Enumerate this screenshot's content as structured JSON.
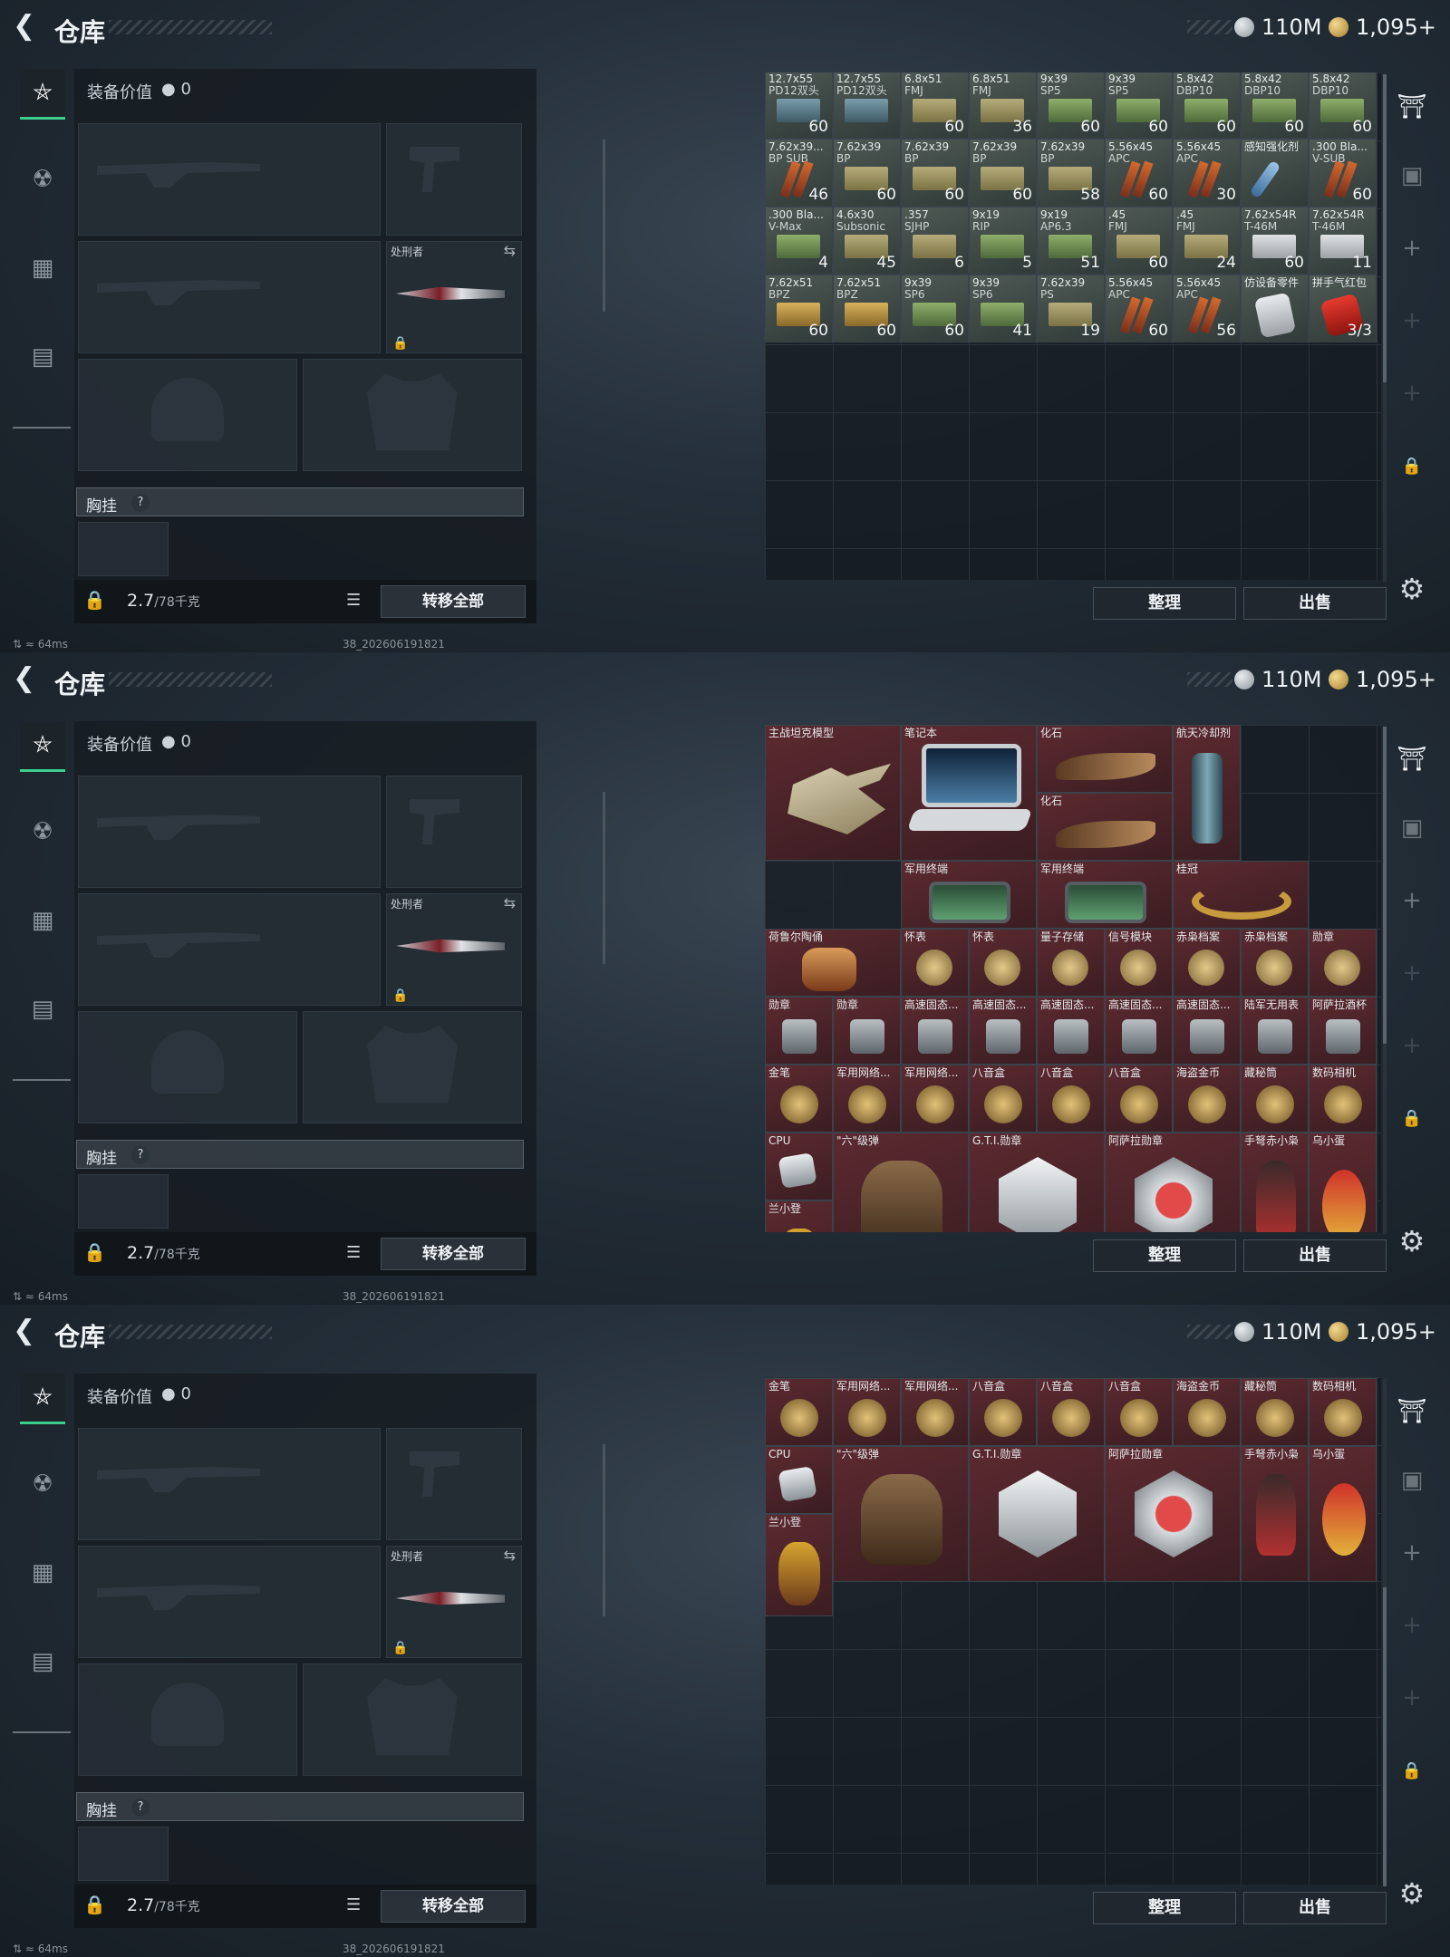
{
  "header": {
    "title": "仓库",
    "silver": "110M",
    "gold": "1,095+"
  },
  "equipment": {
    "value_label": "装备价值",
    "value": "0",
    "knife_label": "处刑者",
    "chest_label": "胸挂",
    "chest_help": "?",
    "weight": "2.7",
    "weight_max": "/78千克",
    "transfer_all": "转移全部"
  },
  "status": {
    "ping": "64ms",
    "build": "38_202606191821"
  },
  "actions": {
    "sort": "整理",
    "sell": "出售"
  },
  "panel1": {
    "rows": [
      [
        {
          "n": "12.7x55",
          "n2": "PD12双头",
          "c": "60",
          "k": "bl"
        },
        {
          "n": "12.7x55",
          "n2": "PD12双头",
          "c": "",
          "k": "bl"
        },
        {
          "n": "6.8x51",
          "n2": "FMJ",
          "c": "60",
          "k": ""
        },
        {
          "n": "6.8x51",
          "n2": "FMJ",
          "c": "36",
          "k": ""
        },
        {
          "n": "9x39",
          "n2": "SP5",
          "c": "60",
          "k": "gr"
        },
        {
          "n": "9x39",
          "n2": "SP5",
          "c": "60",
          "k": "gr"
        },
        {
          "n": "5.8x42",
          "n2": "DBP10",
          "c": "60",
          "k": "gr"
        },
        {
          "n": "5.8x42",
          "n2": "DBP10",
          "c": "60",
          "k": "gr"
        },
        {
          "n": "5.8x42",
          "n2": "DBP10",
          "c": "60",
          "k": "gr"
        }
      ],
      [
        {
          "n": "7.62x39...",
          "n2": "BP SUB",
          "c": "46",
          "k": "st"
        },
        {
          "n": "7.62x39",
          "n2": "BP",
          "c": "60",
          "k": ""
        },
        {
          "n": "7.62x39",
          "n2": "BP",
          "c": "60",
          "k": ""
        },
        {
          "n": "7.62x39",
          "n2": "BP",
          "c": "60",
          "k": ""
        },
        {
          "n": "7.62x39",
          "n2": "BP",
          "c": "58",
          "k": ""
        },
        {
          "n": "5.56x45",
          "n2": "APC",
          "c": "60",
          "k": "st"
        },
        {
          "n": "5.56x45",
          "n2": "APC",
          "c": "30",
          "k": "st"
        },
        {
          "n": "感知强化剂",
          "n2": "",
          "c": "",
          "k": "sy"
        },
        {
          "n": ".300 Bla...",
          "n2": "V-SUB",
          "c": "60",
          "k": "st"
        }
      ],
      [
        {
          "n": ".300 Bla...",
          "n2": "V-Max",
          "c": "4",
          "k": "gr"
        },
        {
          "n": "4.6x30",
          "n2": "Subsonic",
          "c": "45",
          "k": ""
        },
        {
          "n": ".357",
          "n2": "SJHP",
          "c": "6",
          "k": ""
        },
        {
          "n": "9x19",
          "n2": "RIP",
          "c": "5",
          "k": "gr"
        },
        {
          "n": "9x19",
          "n2": "AP6.3",
          "c": "51",
          "k": "gr"
        },
        {
          "n": ".45",
          "n2": "FMJ",
          "c": "60",
          "k": ""
        },
        {
          "n": ".45",
          "n2": "FMJ",
          "c": "24",
          "k": ""
        },
        {
          "n": "7.62x54R",
          "n2": "T-46M",
          "c": "60",
          "k": "wh"
        },
        {
          "n": "7.62x54R",
          "n2": "T-46M",
          "c": "11",
          "k": "wh"
        }
      ],
      [
        {
          "n": "7.62x51",
          "n2": "BPZ",
          "c": "60",
          "k": "gd"
        },
        {
          "n": "7.62x51",
          "n2": "BPZ",
          "c": "60",
          "k": "gd"
        },
        {
          "n": "9x39",
          "n2": "SP6",
          "c": "60",
          "k": "gr"
        },
        {
          "n": "9x39",
          "n2": "SP6",
          "c": "41",
          "k": "gr"
        },
        {
          "n": "7.62x39",
          "n2": "PS",
          "c": "19",
          "k": ""
        },
        {
          "n": "5.56x45",
          "n2": "APC",
          "c": "60",
          "k": "st"
        },
        {
          "n": "5.56x45",
          "n2": "APC",
          "c": "56",
          "k": "st"
        },
        {
          "n": "仿设备零件",
          "n2": "",
          "c": "",
          "k": "pk"
        },
        {
          "n": "拼手气红包",
          "n2": "",
          "c": "3/3",
          "k": "rd"
        }
      ]
    ]
  },
  "panel2": {
    "big": [
      {
        "label": "主战坦克模型",
        "art": "tank"
      },
      {
        "label": "笔记本",
        "art": "laptop"
      },
      {
        "label": "化石",
        "art": "fossil"
      },
      {
        "label": "化石",
        "art": "fossil"
      },
      {
        "label": "航天冷却剂",
        "art": "cool"
      },
      {
        "label": "军用终端",
        "art": "term"
      },
      {
        "label": "军用终端",
        "art": "term"
      },
      {
        "label": "桂冠",
        "art": "crown"
      }
    ],
    "row3": [
      "荷鲁尔陶俑",
      "怀表",
      "怀表",
      "量子存储",
      "信号模块",
      "赤枭档案",
      "赤枭档案",
      "勋章"
    ],
    "row4": [
      "勋章",
      "勋章",
      "高速固态...",
      "高速固态...",
      "高速固态...",
      "高速固态...",
      "高速固态...",
      "陆军无用表",
      "阿萨拉酒杯"
    ],
    "row5": [
      "金笔",
      "军用网络...",
      "军用网络...",
      "八音盒",
      "八音盒",
      "八音盒",
      "海盗金币",
      "藏秘筒",
      "数码相机"
    ],
    "row6": {
      "cpu": "CPU",
      "six": "\"六\"级弹",
      "gti": "G.T.I.勋章",
      "asala": "阿萨拉勋章",
      "red": "手弩赤小枭",
      "bird": "乌小蛋",
      "lan": "兰小登"
    }
  }
}
